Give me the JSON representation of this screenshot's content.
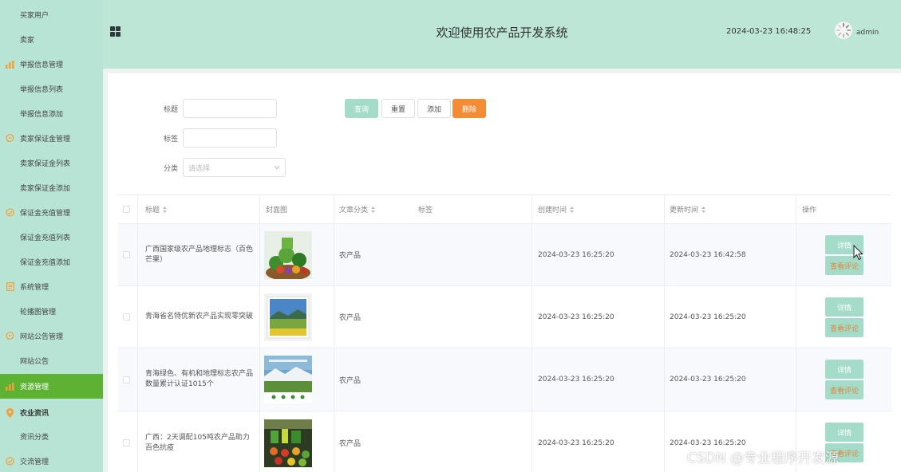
{
  "sidebar": {
    "items": [
      {
        "label": "买家用户"
      },
      {
        "label": "卖家"
      },
      {
        "label": "举报信息管理",
        "icon": "bar-chart-icon"
      },
      {
        "label": "举报信息列表"
      },
      {
        "label": "举报信息添加"
      },
      {
        "label": "卖家保证金管理",
        "icon": "chat-bubble-icon"
      },
      {
        "label": "卖家保证金列表"
      },
      {
        "label": "卖家保证金添加"
      },
      {
        "label": "保证金充值管理",
        "icon": "check-circle-icon"
      },
      {
        "label": "保证金充值列表"
      },
      {
        "label": "保证金充值添加"
      },
      {
        "label": "系统管理",
        "icon": "document-icon"
      },
      {
        "label": "轮播图管理"
      },
      {
        "label": "网站公告管理",
        "icon": "chat-bubble-icon"
      },
      {
        "label": "网站公告"
      },
      {
        "label": "资源管理",
        "icon": "bar-chart-icon"
      },
      {
        "label": "农业资讯",
        "icon": "location-pin-icon"
      },
      {
        "label": "资讯分类"
      },
      {
        "label": "交流管理",
        "icon": "check-circle-icon"
      }
    ]
  },
  "header": {
    "title": "欢迎使用农产品开发系统",
    "datetime": "2024-03-23 16:48:25",
    "username": "admin"
  },
  "filters": {
    "title_label": "标题",
    "tag_label": "标签",
    "category_label": "分类",
    "category_placeholder": "请选择",
    "search_button": "查询",
    "reset_button": "重置",
    "add_button": "添加",
    "delete_button": "删除"
  },
  "table": {
    "columns": {
      "title": "标题",
      "cover": "封面图",
      "category": "文章分类",
      "tag": "标签",
      "created": "创建时间",
      "updated": "更新时间",
      "actions": "操作"
    },
    "rows": [
      {
        "title": "广西国家级农产品地理标志（百色芒果）",
        "category": "农产品",
        "created": "2024-03-23 16:25:20",
        "updated": "2024-03-23 16:42:58",
        "image": "vegetables"
      },
      {
        "title": "青海省名特优新农产品实现零突破",
        "category": "农产品",
        "created": "2024-03-23 16:25:20",
        "updated": "2024-03-23 16:25:20",
        "image": "grassland"
      },
      {
        "title": "青海绿色、有机和地理标志农产品数量累计认证1015个",
        "category": "农产品",
        "created": "2024-03-23 16:25:20",
        "updated": "2024-03-23 16:25:20",
        "image": "poster"
      },
      {
        "title": "广西：2天调配105吨农产品助力百色抗疫",
        "category": "农产品",
        "created": "2024-03-23 16:25:20",
        "updated": "2024-03-23 16:25:20",
        "image": "market"
      }
    ],
    "detail_button": "详情",
    "comment_button": "查看评论"
  },
  "watermark": "CSDN @专业程序开发源",
  "colors": {
    "sidebar_bg": "#b8e4d6",
    "header_bg": "#bde6d7",
    "active_item": "#5db234",
    "primary_button": "#a4dcc9",
    "delete_button": "#f48c35"
  }
}
